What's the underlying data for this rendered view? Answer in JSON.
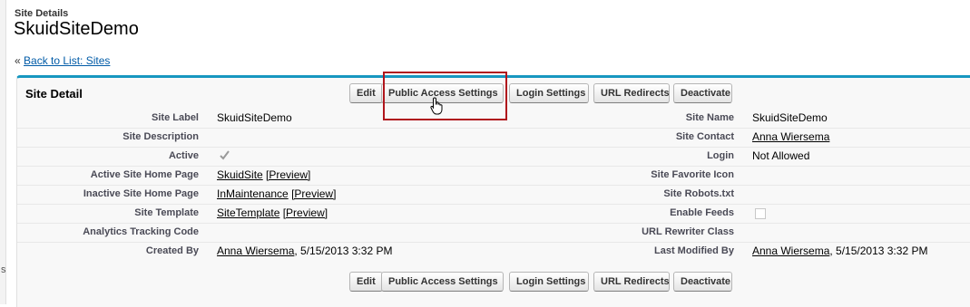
{
  "header": {
    "type_label": "Site Details",
    "title": "SkuidSiteDemo",
    "back_prefix": "«",
    "back_link": "Back to List: Sites"
  },
  "panel": {
    "title": "Site Detail"
  },
  "buttons": {
    "edit": "Edit",
    "public_access": "Public Access Settings",
    "login_settings": "Login Settings",
    "url_redirects": "URL Redirects",
    "deactivate": "Deactivate"
  },
  "fields_left": [
    {
      "label": "Site Label",
      "value": "SkuidSiteDemo"
    },
    {
      "label": "Site Description",
      "value": ""
    },
    {
      "label": "Active",
      "value": "",
      "checked": true
    },
    {
      "label": "Active Site Home Page",
      "link": "SkuidSite",
      "extra": "[Preview]"
    },
    {
      "label": "Inactive Site Home Page",
      "link": "InMaintenance",
      "extra": "[Preview]"
    },
    {
      "label": "Site Template",
      "link": "SiteTemplate",
      "extra": "[Preview]"
    },
    {
      "label": "Analytics Tracking Code",
      "value": ""
    },
    {
      "label": "Created By",
      "link": "Anna Wiersema",
      "suffix": ", 5/15/2013 3:32 PM"
    }
  ],
  "fields_right": [
    {
      "label": "Site Name",
      "value": "SkuidSiteDemo"
    },
    {
      "label": "Site Contact",
      "link": "Anna Wiersema"
    },
    {
      "label": "Login",
      "value": "Not Allowed"
    },
    {
      "label": "Site Favorite Icon",
      "value": ""
    },
    {
      "label": "Site Robots.txt",
      "value": ""
    },
    {
      "label": "Enable Feeds",
      "value": "",
      "checked": false
    },
    {
      "label": "URL Rewriter Class",
      "value": ""
    },
    {
      "label": "Last Modified By",
      "link": "Anna Wiersema",
      "suffix": ", 5/15/2013 3:32 PM"
    }
  ],
  "colors": {
    "panel_accent": "#1797c0",
    "highlight": "#b0151c",
    "link": "#015ba7"
  }
}
